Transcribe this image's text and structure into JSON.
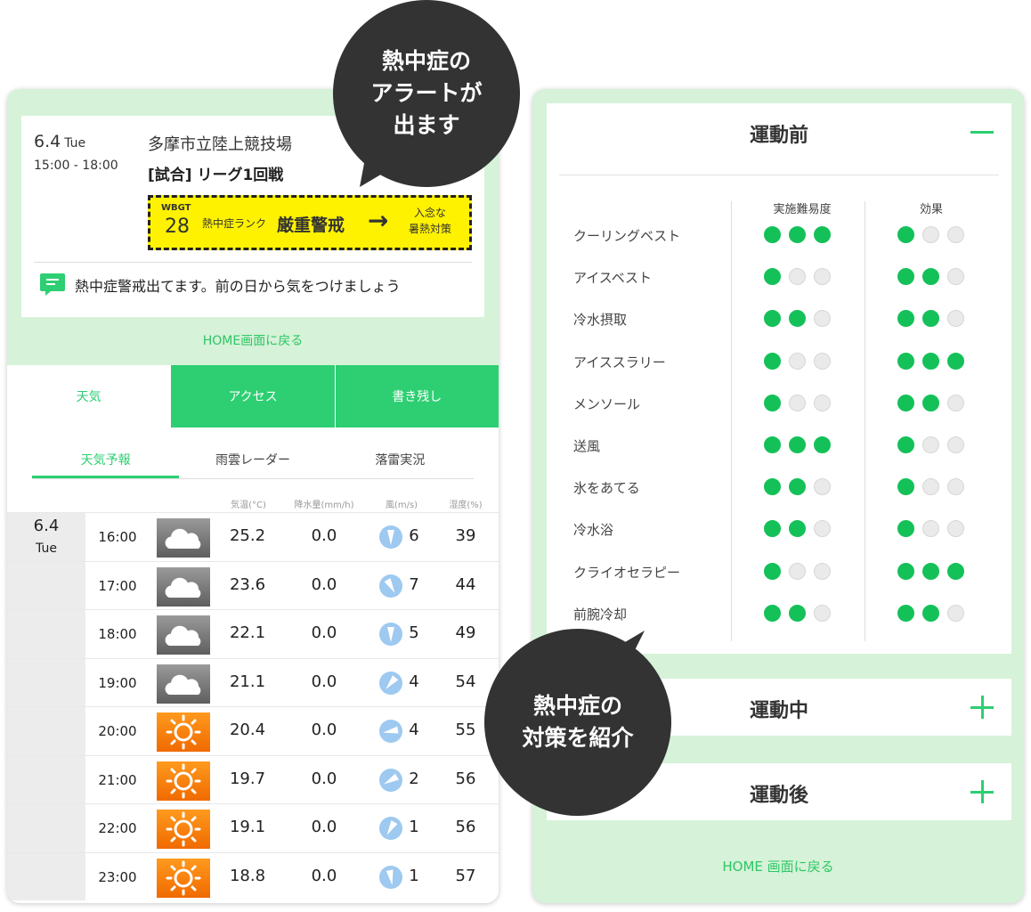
{
  "event": {
    "date": "6.4",
    "weekday": "Tue",
    "time": "15:00 - 18:00",
    "venue": "多摩市立陸上競技場",
    "title": "[試合] リーグ1回戦"
  },
  "alert": {
    "wbgt_label": "WBGT",
    "wbgt_value": "28",
    "rank_label": "熱中症ランク",
    "rank_value": "厳重警戒",
    "measure_line1": "入念な",
    "measure_line2": "暑熱対策",
    "background_color": "#fff200"
  },
  "message": {
    "text": "熱中症警戒出てます。前の日から気をつけましょう",
    "icon": "chat-bubble-icon"
  },
  "home_link_left": "HOME画面に戻る",
  "tabs": [
    {
      "label": "天気",
      "active": true
    },
    {
      "label": "アクセス",
      "active": false
    },
    {
      "label": "書き残し",
      "active": false
    }
  ],
  "subtabs": [
    {
      "label": "天気予報",
      "active": true
    },
    {
      "label": "雨雲レーダー",
      "active": false
    },
    {
      "label": "落雷実況",
      "active": false
    }
  ],
  "weather_columns": {
    "temp": "気温(°C)",
    "rain": "降水量(mm/h)",
    "wind": "風(m/s)",
    "humidity": "湿度(%)"
  },
  "weather_date": {
    "date": "6.4",
    "weekday": "Tue"
  },
  "weather_rows": [
    {
      "time": "16:00",
      "icon": "cloudy-icon",
      "temp": "25.2",
      "rain": "0.0",
      "wind": "6",
      "wind_dir_deg": 0,
      "humidity": "39"
    },
    {
      "time": "17:00",
      "icon": "cloudy-icon",
      "temp": "23.6",
      "rain": "0.0",
      "wind": "7",
      "wind_dir_deg": -30,
      "humidity": "44"
    },
    {
      "time": "18:00",
      "icon": "cloudy-icon",
      "temp": "22.1",
      "rain": "0.0",
      "wind": "5",
      "wind_dir_deg": 0,
      "humidity": "49"
    },
    {
      "time": "19:00",
      "icon": "cloudy-icon",
      "temp": "21.1",
      "rain": "0.0",
      "wind": "4",
      "wind_dir_deg": 40,
      "humidity": "54"
    },
    {
      "time": "20:00",
      "icon": "sunny-icon",
      "temp": "20.4",
      "rain": "0.0",
      "wind": "4",
      "wind_dir_deg": 80,
      "humidity": "55"
    },
    {
      "time": "21:00",
      "icon": "sunny-icon",
      "temp": "19.7",
      "rain": "0.0",
      "wind": "2",
      "wind_dir_deg": 60,
      "humidity": "56"
    },
    {
      "time": "22:00",
      "icon": "sunny-icon",
      "temp": "19.1",
      "rain": "0.0",
      "wind": "1",
      "wind_dir_deg": 30,
      "humidity": "56"
    },
    {
      "time": "23:00",
      "icon": "sunny-icon",
      "temp": "18.8",
      "rain": "0.0",
      "wind": "1",
      "wind_dir_deg": -10,
      "humidity": "57"
    }
  ],
  "measures": {
    "before": {
      "title": "運動前",
      "col_difficulty": "実施難易度",
      "col_effect": "効果",
      "items": [
        {
          "name": "クーリングベスト",
          "difficulty": 3,
          "effect": 1
        },
        {
          "name": "アイスベスト",
          "difficulty": 1,
          "effect": 2
        },
        {
          "name": "冷水摂取",
          "difficulty": 2,
          "effect": 2
        },
        {
          "name": "アイススラリー",
          "difficulty": 1,
          "effect": 3
        },
        {
          "name": "メンソール",
          "difficulty": 1,
          "effect": 2
        },
        {
          "name": "送風",
          "difficulty": 3,
          "effect": 1
        },
        {
          "name": "氷をあてる",
          "difficulty": 2,
          "effect": 1
        },
        {
          "name": "冷水浴",
          "difficulty": 2,
          "effect": 1
        },
        {
          "name": "クライオセラピー",
          "difficulty": 1,
          "effect": 3
        },
        {
          "name": "前腕冷却",
          "difficulty": 2,
          "effect": 2
        }
      ]
    },
    "during": {
      "title": "運動中"
    },
    "after": {
      "title": "運動後"
    }
  },
  "home_link_right": "HOME 画面に戻る",
  "bubbles": {
    "alert": [
      "熱中症の",
      "アラートが",
      "出ます"
    ],
    "measures": [
      "熱中症の",
      "対策を紹介"
    ]
  },
  "colors": {
    "accent": "#2dcf72",
    "panel_bg": "#d6f2d8",
    "dot_on": "#14c158",
    "bubble": "#333333"
  }
}
